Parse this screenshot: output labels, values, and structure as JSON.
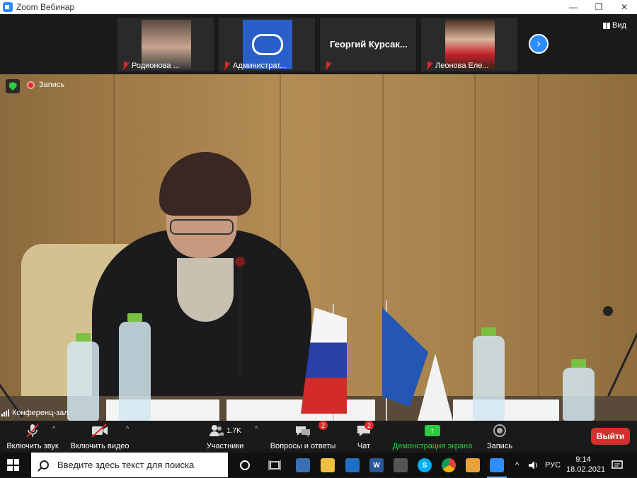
{
  "window": {
    "title": "Zoom Вебинар",
    "minimize": "—",
    "maximize": "❐",
    "close": "✕"
  },
  "gallery": {
    "tiles": [
      {
        "name": "Родионова ..."
      },
      {
        "name": "Администрат..."
      },
      {
        "display_name": "Георгий  Курсак..."
      },
      {
        "name": "Леонова Еле..."
      }
    ],
    "next_label": "›",
    "view_label": "Вид"
  },
  "overlay": {
    "recording_label": "Запись",
    "conference_label": "Конференц-зал"
  },
  "toolbar": {
    "unmute": "Включить звук",
    "start_video": "Включить видео",
    "participants_count": "1.7K",
    "participants": "Участники",
    "qa": "Вопросы и ответы",
    "qa_badge": "2",
    "chat": "Чат",
    "chat_badge": "2",
    "share": "Демонстрация экрана",
    "record": "Запись",
    "leave": "Выйти",
    "caret": "^"
  },
  "taskbar": {
    "search_placeholder": "Введите здесь текст для поиска",
    "apps": [
      "task-view",
      "file-explorer",
      "files",
      "ruler",
      "word",
      "calculator",
      "skype",
      "chrome",
      "media",
      "zoom"
    ],
    "tray_language": "РУС",
    "tray_chevron": "^",
    "time": "9:14",
    "date": "18.02.2021"
  },
  "colors": {
    "accent_blue": "#2d8cff",
    "leave_red": "#d3312f",
    "share_green": "#2ecc40",
    "muted_red": "#e02828"
  }
}
